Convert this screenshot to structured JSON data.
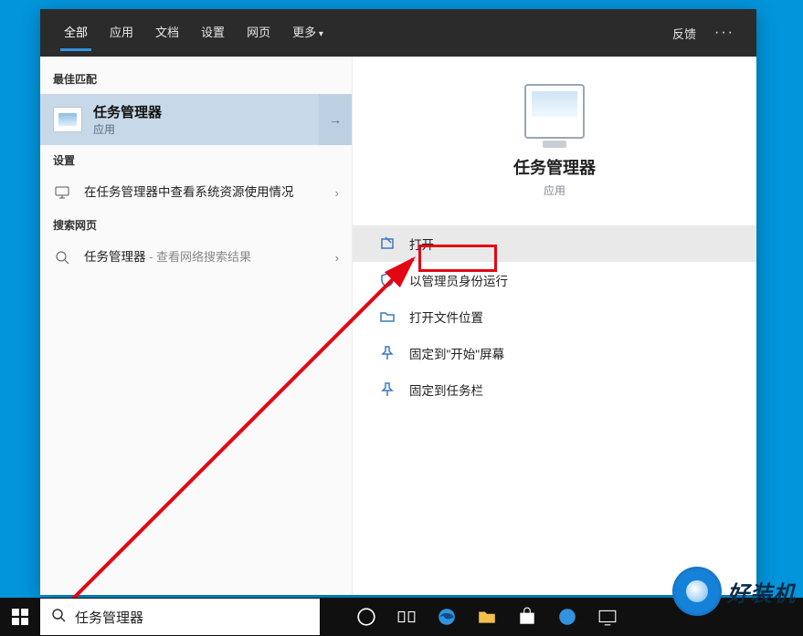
{
  "tabs": {
    "all": "全部",
    "apps": "应用",
    "docs": "文档",
    "settings": "设置",
    "web": "网页",
    "more": "更多",
    "feedback": "反馈",
    "ellipsis": "···"
  },
  "left": {
    "best_match_header": "最佳匹配",
    "best_match": {
      "title": "任务管理器",
      "sub": "应用"
    },
    "settings_header": "设置",
    "settings_item": "在任务管理器中查看系统资源使用情况",
    "web_header": "搜索网页",
    "web_item": {
      "main": "任务管理器",
      "secondary": " - 查看网络搜索结果"
    }
  },
  "right": {
    "title": "任务管理器",
    "sub": "应用",
    "actions": {
      "open": "打开",
      "run_admin": "以管理员身份运行",
      "open_location": "打开文件位置",
      "pin_start": "固定到\"开始\"屏幕",
      "pin_taskbar": "固定到任务栏"
    }
  },
  "search": {
    "value": "任务管理器"
  },
  "watermark": "好装机"
}
